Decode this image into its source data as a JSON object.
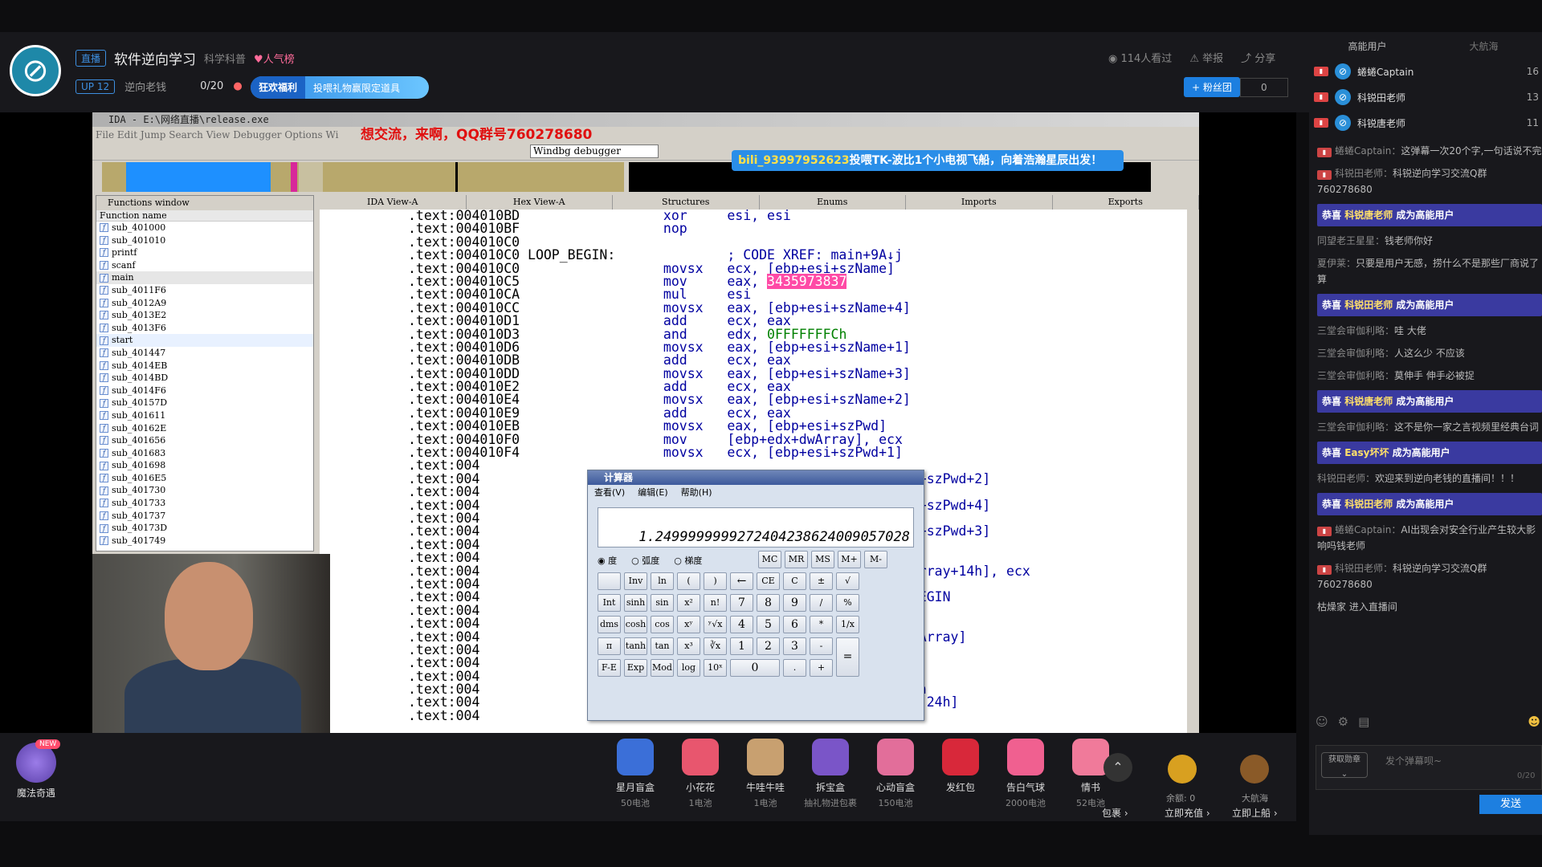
{
  "header": {
    "live_tag": "直播",
    "room_title": "软件逆向学习",
    "category": "科学科普",
    "hot_label": "人气榜",
    "up_level": "UP 12",
    "streamer": "逆向老钱",
    "progress": "0/20",
    "gift_promo": "狂欢福利",
    "gift_promo_sub": "投喂礼物赢限定道具",
    "viewers": "114人看过",
    "report": "举报",
    "share": "分享",
    "fan_button": "+ 粉丝团",
    "fan_count": "0"
  },
  "ida": {
    "title": "IDA - E:\\网络直播\\release.exe",
    "menu": "File Edit Jump Search View Debugger Options Wi",
    "overlay_text": "想交流，来啊，QQ群号760278680",
    "debugger": "Windbg debugger",
    "toast_user": "bili_93997952623",
    "toast_text": "投喂TK-波比1个小电视飞船，向着浩瀚星辰出发！",
    "func_window": "Functions window",
    "func_col": "Function name",
    "functions": [
      "sub_401000",
      "sub_401010",
      "printf",
      "scanf",
      "main",
      "sub_4011F6",
      "sub_4012A9",
      "sub_4013E2",
      "sub_4013F6",
      "start",
      "sub_401447",
      "sub_4014EB",
      "sub_4014BD",
      "sub_4014F6",
      "sub_40157D",
      "sub_401611",
      "sub_40162E",
      "sub_401656",
      "sub_401683",
      "sub_401698",
      "sub_4016E5",
      "sub_401730",
      "sub_401733",
      "sub_401737",
      "sub_40173D",
      "sub_401749"
    ],
    "tabs": [
      "IDA View-A",
      "Hex View-A",
      "Structures",
      "Enums",
      "Imports",
      "Exports"
    ],
    "code": [
      {
        "a": ".text:004010BD",
        "m": "xor",
        "o": "esi, esi"
      },
      {
        "a": ".text:004010BF",
        "m": "nop",
        "o": ""
      },
      {
        "a": ".text:004010C0",
        "m": "",
        "o": ""
      },
      {
        "a": ".text:004010C0 LOOP_BEGIN:",
        "m": "",
        "o": "",
        "c": "; CODE XREF: main+9A↓j"
      },
      {
        "a": ".text:004010C0",
        "m": "movsx",
        "o": "ecx, [ebp+esi+szName]"
      },
      {
        "a": ".text:004010C5",
        "m": "mov",
        "o": "eax, ",
        "h": "3435973837"
      },
      {
        "a": ".text:004010CA",
        "m": "mul",
        "o": "esi"
      },
      {
        "a": ".text:004010CC",
        "m": "movsx",
        "o": "eax, [ebp+esi+szName+4]"
      },
      {
        "a": ".text:004010D1",
        "m": "add",
        "o": "ecx, eax"
      },
      {
        "a": ".text:004010D3",
        "m": "and",
        "o": "edx, ",
        "g": "0FFFFFFFCh"
      },
      {
        "a": ".text:004010D6",
        "m": "movsx",
        "o": "eax, [ebp+esi+szName+1]"
      },
      {
        "a": ".text:004010DB",
        "m": "add",
        "o": "ecx, eax"
      },
      {
        "a": ".text:004010DD",
        "m": "movsx",
        "o": "eax, [ebp+esi+szName+3]"
      },
      {
        "a": ".text:004010E2",
        "m": "add",
        "o": "ecx, eax"
      },
      {
        "a": ".text:004010E4",
        "m": "movsx",
        "o": "eax, [ebp+esi+szName+2]"
      },
      {
        "a": ".text:004010E9",
        "m": "add",
        "o": "ecx, eax"
      },
      {
        "a": ".text:004010EB",
        "m": "movsx",
        "o": "eax, [ebp+esi+szPwd]"
      },
      {
        "a": ".text:004010F0",
        "m": "mov",
        "o": "[ebp+edx+dwArray], ecx"
      },
      {
        "a": ".text:004010F4",
        "m": "movsx",
        "o": "ecx, [ebp+esi+szPwd+1]"
      },
      {
        "a": ".text:004",
        "m": "",
        "o": ""
      },
      {
        "a": ".text:004",
        "m": "",
        "o": "                    +szPwd+2]"
      },
      {
        "a": ".text:004",
        "m": "",
        "o": ""
      },
      {
        "a": ".text:004",
        "m": "",
        "o": "                    +szPwd+4]"
      },
      {
        "a": ".text:004",
        "m": "",
        "o": ""
      },
      {
        "a": ".text:004",
        "m": "",
        "o": "                    +szPwd+3]"
      },
      {
        "a": ".text:004",
        "m": "",
        "o": ""
      },
      {
        "a": ".text:004",
        "m": "",
        "o": ""
      },
      {
        "a": ".text:004",
        "m": "",
        "o": "                    rray+14h], ecx"
      },
      {
        "a": ".text:004",
        "m": "",
        "o": ""
      },
      {
        "a": ".text:004",
        "m": "",
        "o": "                    EGIN"
      },
      {
        "a": ".text:004",
        "m": "",
        "o": ""
      },
      {
        "a": ".text:004",
        "m": "",
        "o": ""
      },
      {
        "a": ".text:004",
        "m": "",
        "o": "                    Array]"
      },
      {
        "a": ".text:004",
        "m": "",
        "o": ""
      },
      {
        "a": ".text:004",
        "m": "",
        "o": ""
      },
      {
        "a": ".text:004",
        "m": "",
        "o": "                    ]"
      },
      {
        "a": ".text:004",
        "m": "",
        "o": "                    h"
      },
      {
        "a": ".text:004",
        "m": "",
        "o": "                    -24h]"
      },
      {
        "a": ".text:004",
        "m": "",
        "o": ""
      }
    ]
  },
  "calc": {
    "title": "计算器",
    "menu": [
      "查看(V)",
      "编辑(E)",
      "帮助(H)"
    ],
    "display": "1.2499999999272404238624009057028",
    "radios": [
      "度",
      "弧度",
      "梯度"
    ],
    "mem_keys": [
      "MC",
      "MR",
      "MS",
      "M+",
      "M-"
    ],
    "rows": [
      [
        "",
        "Inv",
        "ln",
        "(",
        ")",
        "←",
        "CE",
        "C",
        "±",
        "√"
      ],
      [
        "Int",
        "sinh",
        "sin",
        "x²",
        "n!",
        "7",
        "8",
        "9",
        "/",
        "%"
      ],
      [
        "dms",
        "cosh",
        "cos",
        "xʸ",
        "ʸ√x",
        "4",
        "5",
        "6",
        "*",
        "1/x"
      ],
      [
        "π",
        "tanh",
        "tan",
        "x³",
        "∛x",
        "1",
        "2",
        "3",
        "-",
        "="
      ],
      [
        "F-E",
        "Exp",
        "Mod",
        "log",
        "10ˣ",
        "0",
        ".",
        "+"
      ]
    ]
  },
  "right_panel": {
    "tab_high": "高能用户",
    "tab_nav": "大航海",
    "vips": [
      {
        "name": "蜷蜷Captain",
        "num": "16"
      },
      {
        "name": "科锐田老师",
        "num": "13"
      },
      {
        "name": "科锐唐老师",
        "num": "11"
      }
    ],
    "messages": [
      {
        "type": "u",
        "lv": true,
        "user": "蜷蜷Captain：",
        "text": "这弹幕一次20个字,一句话说不完"
      },
      {
        "type": "u",
        "lv": true,
        "user": "科锐田老师：",
        "text": "科锐逆向学习交流Q群760278680"
      },
      {
        "type": "s",
        "pre": "恭喜",
        "name": "科锐唐老师",
        "post": "成为高能用户"
      },
      {
        "type": "u",
        "lv": false,
        "user": "同望老王星星：",
        "text": "钱老师你好"
      },
      {
        "type": "u",
        "lv": false,
        "user": "夏伊莱：",
        "text": "只要是用户无感，捞什么不是那些厂商说了算"
      },
      {
        "type": "s",
        "pre": "恭喜",
        "name": "科锐田老师",
        "post": "成为高能用户"
      },
      {
        "type": "u",
        "lv": false,
        "user": "三堂会审伽利略：",
        "text": "哇 大佬"
      },
      {
        "type": "u",
        "lv": false,
        "user": "三堂会审伽利略：",
        "text": "人这么少 不应该"
      },
      {
        "type": "u",
        "lv": false,
        "user": "三堂会审伽利略：",
        "text": "莫伸手 伸手必被捉"
      },
      {
        "type": "s",
        "pre": "恭喜",
        "name": "科锐唐老师",
        "post": "成为高能用户"
      },
      {
        "type": "u",
        "lv": false,
        "user": "三堂会审伽利略：",
        "text": "这不是你一家之言视频里经典台词"
      },
      {
        "type": "s",
        "pre": "恭喜",
        "name": "Easy坏坏",
        "post": "成为高能用户"
      },
      {
        "type": "u",
        "lv": false,
        "user": "科锐田老师：",
        "text": "欢迎来到逆向老钱的直播间！！！"
      },
      {
        "type": "s",
        "pre": "恭喜",
        "name": "科锐田老师",
        "post": "成为高能用户"
      },
      {
        "type": "u",
        "lv": true,
        "user": "蜷蜷Captain：",
        "text": "AI出现会对安全行业产生较大影响吗钱老师"
      },
      {
        "type": "u",
        "lv": true,
        "user": "科锐田老师：",
        "text": "科锐逆向学习交流Q群760278680"
      },
      {
        "type": "u",
        "lv": false,
        "user": "",
        "text": "枯燥家 进入直播间"
      }
    ],
    "input_placeholder": "发个弹幕呗~",
    "input_count": "0/20",
    "badge_btn": "获取勋章",
    "send": "发送"
  },
  "gifts": {
    "magic": "魔法奇遇",
    "magic_new": "NEW",
    "items": [
      {
        "name": "星月盲盒",
        "price": "50电池",
        "color": "#3b6fd8"
      },
      {
        "name": "小花花",
        "price": "1电池",
        "color": "#e8566e"
      },
      {
        "name": "牛哇牛哇",
        "price": "1电池",
        "color": "#c8a070"
      },
      {
        "name": "拆宝盒",
        "price": "抽礼物进包裹",
        "color": "#7a55c8"
      },
      {
        "name": "心动盲盒",
        "price": "150电池",
        "color": "#e26e9a"
      },
      {
        "name": "发红包",
        "price": "",
        "color": "#d8283a"
      },
      {
        "name": "告白气球",
        "price": "2000电池",
        "color": "#f06090"
      },
      {
        "name": "情书",
        "price": "52电池",
        "color": "#f07a9a"
      }
    ],
    "bag": "包裹",
    "balance": "余额: 0",
    "recharge": "立即充值",
    "navigation": "大航海",
    "board": "立即上船"
  }
}
